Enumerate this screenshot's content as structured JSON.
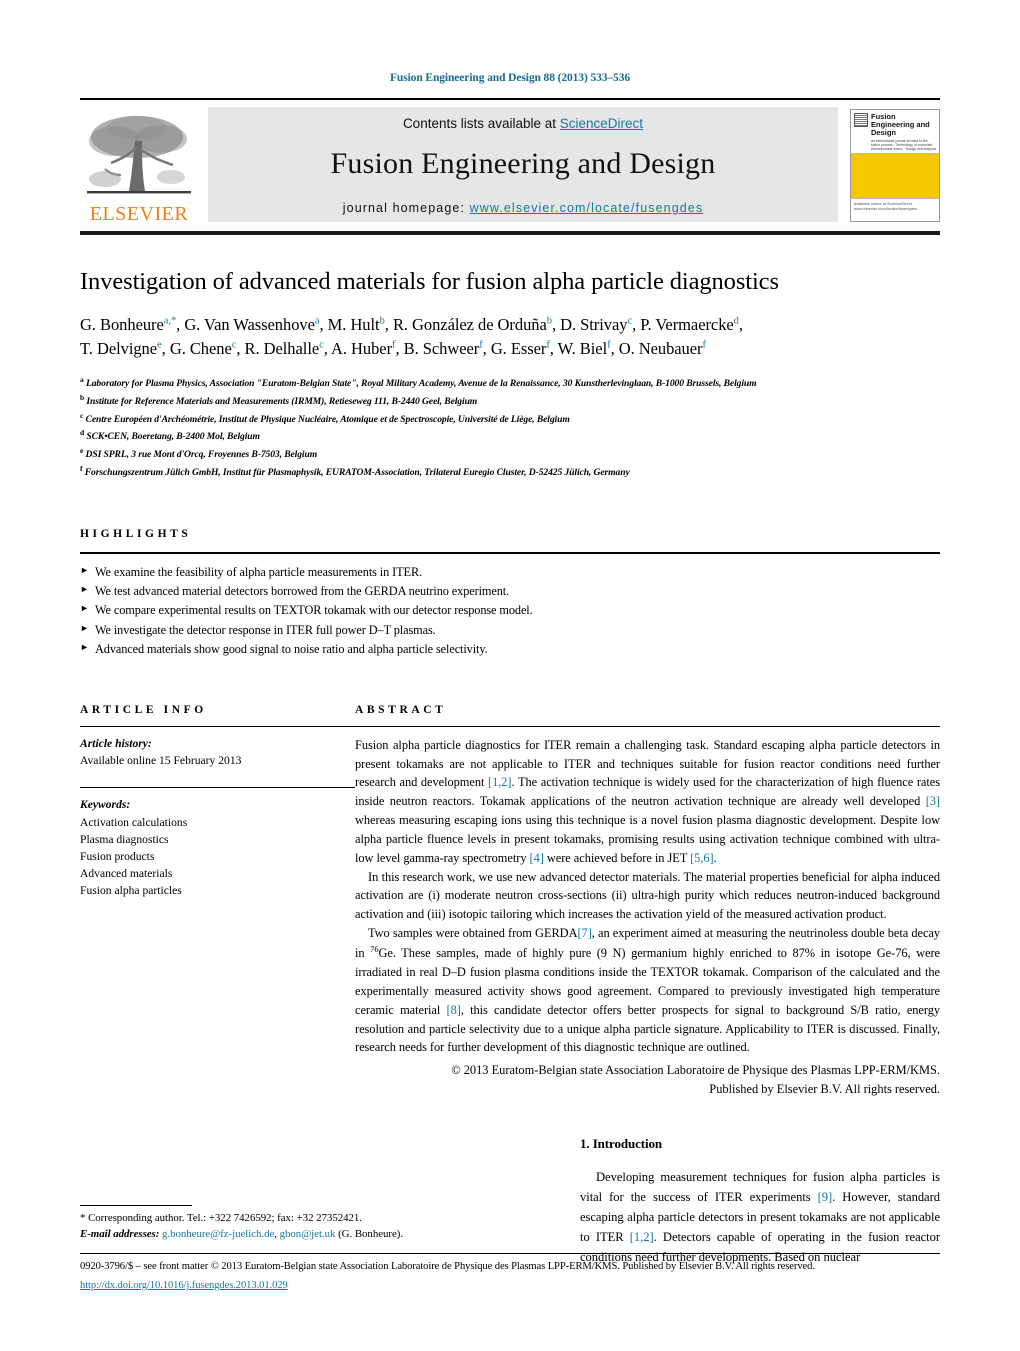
{
  "running_head": "Fusion Engineering and Design 88 (2013) 533–536",
  "masthead": {
    "contents_prefix": "Contents lists available at ",
    "sciencedirect": "ScienceDirect",
    "journal_title": "Fusion Engineering and Design",
    "homepage_prefix": "journal homepage: ",
    "homepage_url": "www.elsevier.com/locate/fusengdes",
    "publisher": "ELSEVIER",
    "cover": {
      "title": "Fusion Engineering and Design",
      "subtitle": "an international journal devoted to the fusion process · Technology of controlled thermonuclear fusion · Design and analysis",
      "footer": "available online at\nScienceDirect\nwww.elsevier.com/locate/fusengdes"
    },
    "accent_link_color": "#1479a0",
    "cover_yellow": "#f5c800",
    "elsevier_orange": "#f07f13"
  },
  "article": {
    "title": "Investigation of advanced materials for fusion alpha particle diagnostics",
    "authors_line_1": "G. Bonheure<a,*>, G. Van Wassenhove<a>, M. Hult<b>, R. González de Orduña<b>, D. Strivay<c>, P. Vermaercke<d>,",
    "authors_line_2": "T. Delvigne<e>, G. Chene<c>, R. Delhalle<c>, A. Huber<f>, B. Schweer<f>, G. Esser<f>, W. Biel<f>, O. Neubauer<f>",
    "authors": [
      {
        "name": "G. Bonheure",
        "sup": "a,*"
      },
      {
        "name": "G. Van Wassenhove",
        "sup": "a"
      },
      {
        "name": "M. Hult",
        "sup": "b"
      },
      {
        "name": "R. González de Orduña",
        "sup": "b"
      },
      {
        "name": "D. Strivay",
        "sup": "c"
      },
      {
        "name": "P. Vermaercke",
        "sup": "d"
      },
      {
        "name": "T. Delvigne",
        "sup": "e"
      },
      {
        "name": "G. Chene",
        "sup": "c"
      },
      {
        "name": "R. Delhalle",
        "sup": "c"
      },
      {
        "name": "A. Huber",
        "sup": "f"
      },
      {
        "name": "B. Schweer",
        "sup": "f"
      },
      {
        "name": "G. Esser",
        "sup": "f"
      },
      {
        "name": "W. Biel",
        "sup": "f"
      },
      {
        "name": "O. Neubauer",
        "sup": "f"
      }
    ],
    "affiliations": [
      {
        "mark": "a",
        "text": "Laboratory for Plasma Physics, Association \"Euratom-Belgian State\", Royal Military Academy, Avenue de la Renaissance, 30 Kunstherlevinglaan, B-1000 Brussels, Belgium"
      },
      {
        "mark": "b",
        "text": "Institute for Reference Materials and Measurements (IRMM), Retieseweg 111, B-2440 Geel, Belgium"
      },
      {
        "mark": "c",
        "text": "Centre Européen d'Archéométrie, Institut de Physique Nucléaire, Atomique et de Spectroscopie, Université de Liège, Belgium"
      },
      {
        "mark": "d",
        "text": "SCK•CEN, Boeretang, B-2400 Mol, Belgium"
      },
      {
        "mark": "e",
        "text": "DSI SPRL, 3 rue Mont d'Orcq, Froyennes B-7503, Belgium"
      },
      {
        "mark": "f",
        "text": "Forschungszentrum Jülich GmbH, Institut für Plasmaphysik, EURATOM-Association, Trilateral Euregio Cluster, D-52425 Jülich, Germany"
      }
    ]
  },
  "highlights": {
    "label": "HIGHLIGHTS",
    "bullet_glyph": "►",
    "items": [
      "We examine the feasibility of alpha particle measurements in ITER.",
      "We test advanced material detectors borrowed from the GERDA neutrino experiment.",
      "We compare experimental results on TEXTOR tokamak with our detector response model.",
      "We investigate the detector response in ITER full power D–T plasmas.",
      "Advanced materials show good signal to noise ratio and alpha particle selectivity."
    ]
  },
  "article_info": {
    "label": "ARTICLE INFO",
    "history_label": "Article history:",
    "history_value": "Available online 15 February 2013",
    "keywords_label": "Keywords:",
    "keywords": [
      "Activation calculations",
      "Plasma diagnostics",
      "Fusion products",
      "Advanced materials",
      "Fusion alpha particles"
    ]
  },
  "abstract": {
    "label": "ABSTRACT",
    "paragraphs": [
      "Fusion alpha particle diagnostics for ITER remain a challenging task. Standard escaping alpha particle detectors in present tokamaks are not applicable to ITER and techniques suitable for fusion reactor conditions need further research and development [1,2]. The activation technique is widely used for the characterization of high fluence rates inside neutron reactors. Tokamak applications of the neutron activation technique are already well developed [3] whereas measuring escaping ions using this technique is a novel fusion plasma diagnostic development. Despite low alpha particle fluence levels in present tokamaks, promising results using activation technique combined with ultra-low level gamma-ray spectrometry [4] were achieved before in JET [5,6].",
      "In this research work, we use new advanced detector materials. The material properties beneficial for alpha induced activation are (i) moderate neutron cross-sections (ii) ultra-high purity which reduces neutron-induced background activation and (iii) isotopic tailoring which increases the activation yield of the measured activation product.",
      "Two samples were obtained from GERDA[7], an experiment aimed at measuring the neutrinoless double beta decay in 76Ge. These samples, made of highly pure (9 N) germanium highly enriched to 87% in isotope Ge-76, were irradiated in real D–D fusion plasma conditions inside the TEXTOR tokamak. Comparison of the calculated and the experimentally measured activity shows good agreement. Compared to previously investigated high temperature ceramic material [8], this candidate detector offers better prospects for signal to background S/B ratio, energy resolution and particle selectivity due to a unique alpha particle signature. Applicability to ITER is discussed. Finally, research needs for further development of this diagnostic technique are outlined."
    ],
    "copyright_line_1": "© 2013 Euratom-Belgian state Association Laboratoire de Physique des Plasmas LPP-ERM/KMS.",
    "copyright_line_2": "Published by Elsevier B.V. All rights reserved."
  },
  "introduction": {
    "heading": "1.  Introduction",
    "text": "Developing measurement techniques for fusion alpha particles is vital for the success of ITER experiments [9]. However, standard escaping alpha particle detectors in present tokamaks are not applicable to ITER [1,2]. Detectors capable of operating in the fusion reactor conditions need further developments. Based on nuclear"
  },
  "footnote": {
    "corresponding": "* Corresponding author. Tel.: +322 7426592; fax: +32 27352421.",
    "email_label": "E-mail addresses:",
    "email_1": "g.bonheure@fz-juelich.de",
    "email_2": "gbon@jet.uk",
    "email_owner": "(G. Bonheure)."
  },
  "footer": {
    "issn_line": "0920-3796/$ – see front matter © 2013 Euratom-Belgian state Association Laboratoire de Physique des Plasmas LPP-ERM/KMS.  Published by Elsevier B.V. All rights reserved.",
    "doi": "http://dx.doi.org/10.1016/j.fusengdes.2013.01.029"
  }
}
